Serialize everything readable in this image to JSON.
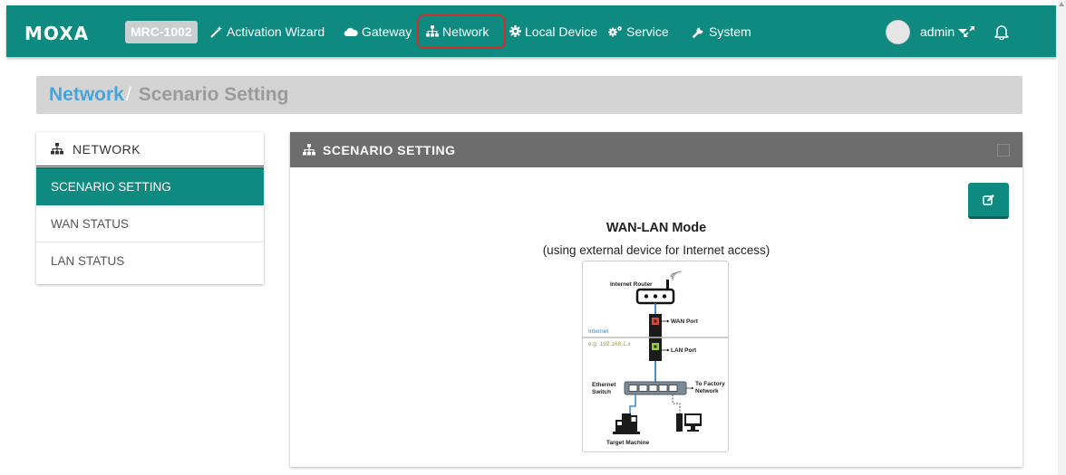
{
  "navbar": {
    "logo": "MOXA",
    "model": "MRC-1002",
    "items": [
      {
        "label": "Activation Wizard",
        "icon": "wand-icon"
      },
      {
        "label": "Gateway",
        "icon": "cloud-icon"
      },
      {
        "label": "Network",
        "icon": "network-icon"
      },
      {
        "label": "Local Device",
        "icon": "gear-icon"
      },
      {
        "label": "Service",
        "icon": "gears-icon"
      },
      {
        "label": "System",
        "icon": "wrench-icon"
      }
    ],
    "user": "admin"
  },
  "breadcrumb": {
    "parent": "Network",
    "separator": "/",
    "current": "Scenario Setting"
  },
  "sidebar": {
    "header": "NETWORK",
    "items": [
      {
        "label": "SCENARIO SETTING",
        "active": true
      },
      {
        "label": "WAN STATUS",
        "active": false
      },
      {
        "label": "LAN STATUS",
        "active": false
      }
    ]
  },
  "panel": {
    "title": "SCENARIO SETTING",
    "mode_title": "WAN-LAN Mode",
    "mode_subtitle": "(using external device for Internet access)"
  },
  "diagram": {
    "internet_router": "Internet Router",
    "wan_port": "WAN Port",
    "lan_port": "LAN Port",
    "internet": "Internet",
    "ip_example": "e.g. 192.168.1.x",
    "ethernet_switch_line1": "Ethernet",
    "ethernet_switch_line2": "Switch",
    "to_factory_line1": "To Factory",
    "to_factory_line2": "Network",
    "target_machine": "Target Machine"
  },
  "colors": {
    "brand": "#0f8a80",
    "highlight": "#d32f2f",
    "link": "#44a5dc",
    "panel_header": "#6d6d6d"
  }
}
